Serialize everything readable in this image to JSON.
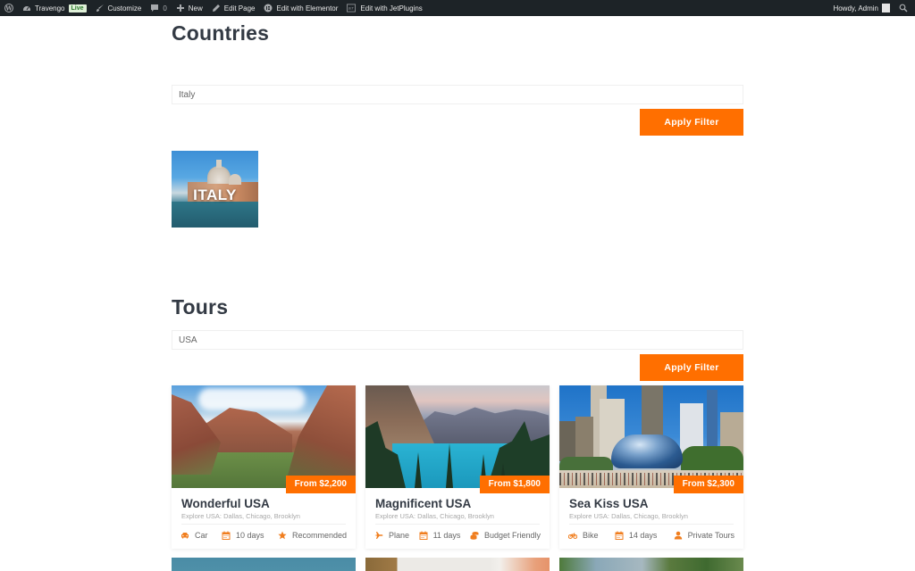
{
  "adminbar": {
    "site_name": "Travengo",
    "live_badge": "Live",
    "customize": "Customize",
    "comments_count": "0",
    "new": "New",
    "edit_page": "Edit Page",
    "edit_elementor": "Edit with Elementor",
    "edit_jetplugins": "Edit with JetPlugins",
    "greeting": "Howdy, Admin"
  },
  "countries": {
    "title": "Countries",
    "filter_value": "Italy",
    "apply_label": "Apply Filter",
    "results": [
      {
        "label": "ITALY"
      }
    ]
  },
  "tours": {
    "title": "Tours",
    "filter_value": "USA",
    "apply_label": "Apply Filter",
    "accent_color": "#ff6f00",
    "cards": [
      {
        "title": "Wonderful USA",
        "price": "From $2,200",
        "subtitle": "Explore USA: Dallas, Chicago, Brooklyn",
        "transport": "Car",
        "transport_icon": "car-icon",
        "duration": "10 days",
        "tag": "Recommended",
        "tag_icon": "star-icon"
      },
      {
        "title": "Magnificent USA",
        "price": "From $1,800",
        "subtitle": "Explore USA: Dallas, Chicago, Brooklyn",
        "transport": "Plane",
        "transport_icon": "plane-icon",
        "duration": "11 days",
        "tag": "Budget Friendly",
        "tag_icon": "coins-icon"
      },
      {
        "title": "Sea Kiss USA",
        "price": "From $2,300",
        "subtitle": "Explore USA: Dallas, Chicago, Brooklyn",
        "transport": "Bike",
        "transport_icon": "bike-icon",
        "duration": "14 days",
        "tag": "Private Tours",
        "tag_icon": "person-icon"
      }
    ]
  }
}
